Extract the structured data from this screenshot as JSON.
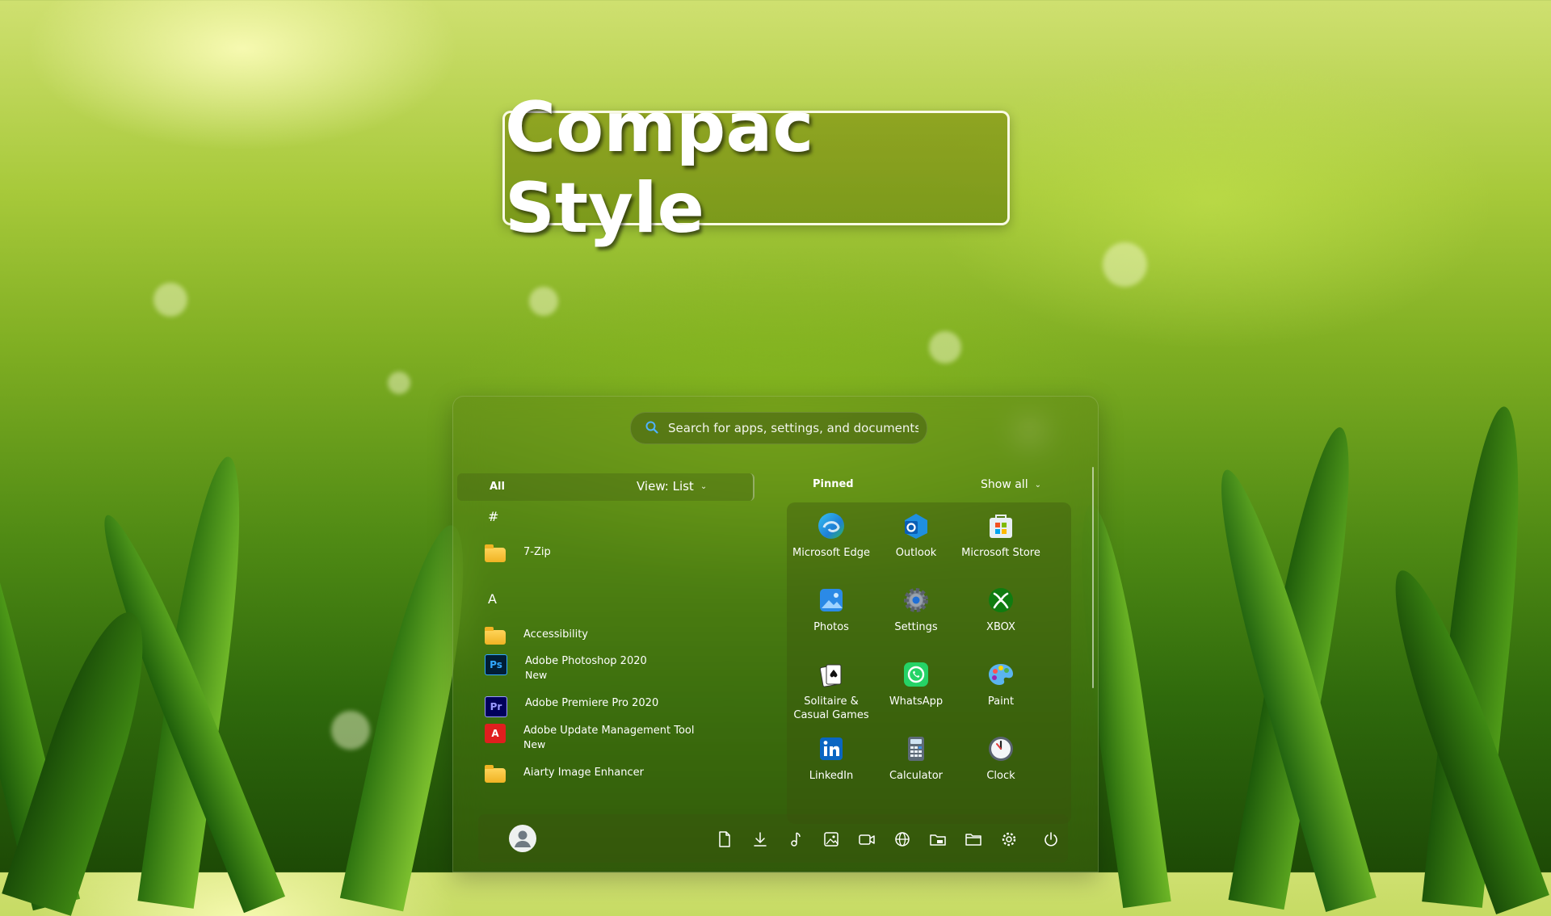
{
  "banner": {
    "title": "Compac Style"
  },
  "search": {
    "placeholder": "Search for apps, settings, and documents"
  },
  "all_apps": {
    "header_label": "All",
    "view_label": "View: List",
    "groups": [
      {
        "letter": "#",
        "items": [
          {
            "label": "7-Zip",
            "sub": "",
            "icon": "folder-icon"
          }
        ]
      },
      {
        "letter": "A",
        "items": [
          {
            "label": "Accessibility",
            "sub": "",
            "icon": "folder-icon"
          },
          {
            "label": "Adobe Photoshop 2020",
            "sub": "New",
            "icon": "photoshop-icon"
          },
          {
            "label": "Adobe Premiere Pro 2020",
            "sub": "",
            "icon": "premiere-icon"
          },
          {
            "label": "Adobe Update Management Tool",
            "sub": "New",
            "icon": "adobe-update-icon"
          },
          {
            "label": "Aiarty Image Enhancer",
            "sub": "",
            "icon": "folder-icon"
          }
        ]
      }
    ]
  },
  "pinned": {
    "header_label": "Pinned",
    "show_all_label": "Show all",
    "apps": [
      {
        "label": "Microsoft Edge",
        "icon": "edge-icon"
      },
      {
        "label": "Outlook",
        "icon": "outlook-icon"
      },
      {
        "label": "Microsoft Store",
        "icon": "store-icon"
      },
      {
        "label": "Photos",
        "icon": "photos-icon"
      },
      {
        "label": "Settings",
        "icon": "settings-icon"
      },
      {
        "label": "XBOX",
        "icon": "xbox-icon"
      },
      {
        "label": "Solitaire & Casual Games",
        "icon": "solitaire-icon"
      },
      {
        "label": "WhatsApp",
        "icon": "whatsapp-icon"
      },
      {
        "label": "Paint",
        "icon": "paint-icon"
      },
      {
        "label": "LinkedIn",
        "icon": "linkedin-icon"
      },
      {
        "label": "Calculator",
        "icon": "calculator-icon"
      },
      {
        "label": "Clock",
        "icon": "clock-icon"
      }
    ]
  },
  "taskbar": {
    "icons": [
      "document-icon",
      "download-icon",
      "music-icon",
      "image-icon",
      "video-icon",
      "network-icon",
      "file-explorer-icon",
      "folder-icon",
      "gear-icon",
      "power-icon"
    ]
  },
  "colors": {
    "accent": "#8aa82a",
    "text": "#ffffff"
  }
}
